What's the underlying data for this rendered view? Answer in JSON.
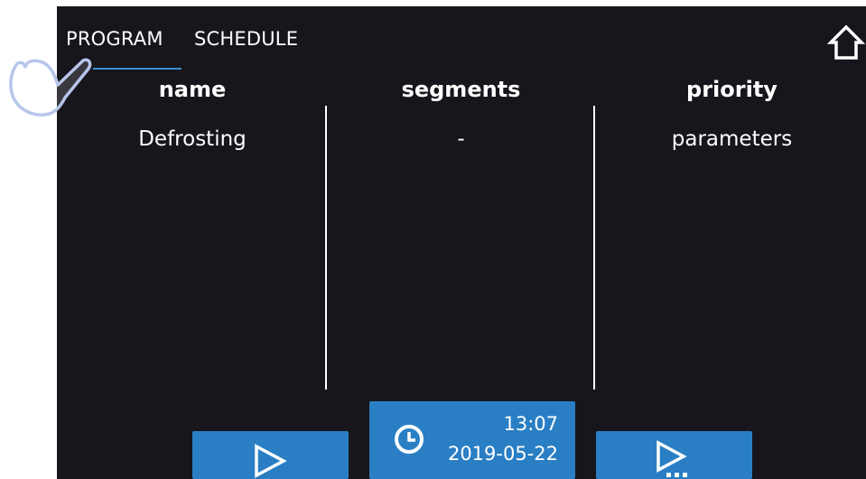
{
  "tabs": [
    {
      "label": "PROGRAM",
      "active": true
    },
    {
      "label": "SCHEDULE",
      "active": false
    }
  ],
  "table": {
    "headers": [
      "name",
      "segments",
      "priority"
    ],
    "rows": [
      [
        "Defrosting",
        "-",
        "parameters"
      ]
    ]
  },
  "datetime": {
    "time": "13:07",
    "date": "2019-05-22"
  },
  "icons": {
    "home": "home-icon",
    "start": "play-icon",
    "start_options": "play-more-icon",
    "clock": "clock-icon",
    "touch": "hand-pointer-icon"
  },
  "colors": {
    "background": "#16161c",
    "accent": "#2a7fc4",
    "tab_underline": "#3b8fd0",
    "text": "#ffffff"
  }
}
